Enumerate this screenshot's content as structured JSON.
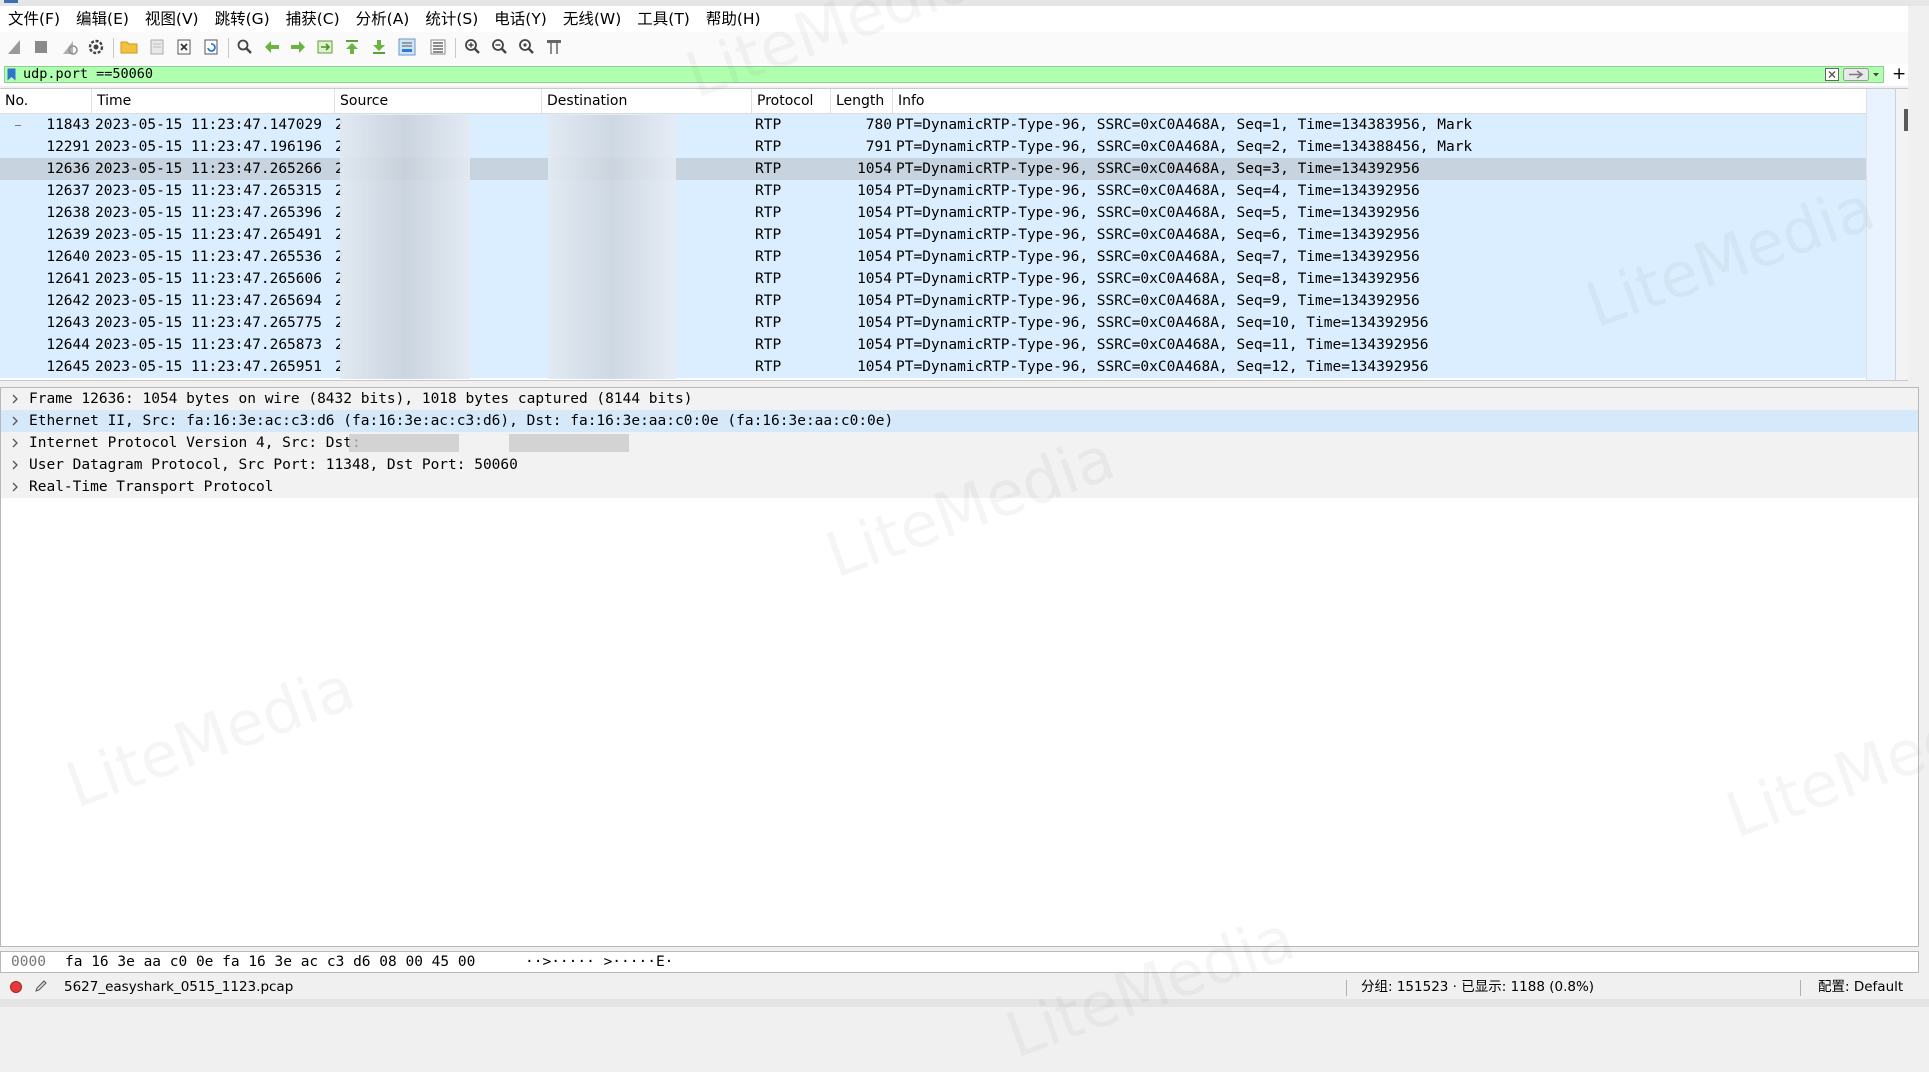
{
  "menu": [
    "文件(F)",
    "编辑(E)",
    "视图(V)",
    "跳转(G)",
    "捕获(C)",
    "分析(A)",
    "统计(S)",
    "电话(Y)",
    "无线(W)",
    "工具(T)",
    "帮助(H)"
  ],
  "toolbar_icons": [
    "shark-fin-start-icon",
    "stop-square-icon",
    "restart-fin-icon",
    "capture-options-gear-icon",
    "open-folder-icon",
    "save-file-icon",
    "close-file-icon",
    "reload-file-icon",
    "find-packet-icon",
    "go-back-icon",
    "go-forward-icon",
    "go-to-packet-icon",
    "first-packet-icon",
    "last-packet-icon",
    "auto-scroll-icon",
    "colorize-icon",
    "zoom-in-icon",
    "zoom-out-icon",
    "zoom-normal-icon",
    "resize-columns-icon"
  ],
  "filter": {
    "value": "udp.port ==50060"
  },
  "columns": [
    "No.",
    "Time",
    "Source",
    "Destination",
    "Protocol",
    "Length",
    "Info"
  ],
  "packets": [
    {
      "no": "11843",
      "time": "2023-05-15 11:23:47.147029",
      "source": "2",
      "dest": "",
      "proto": "RTP",
      "len": "780",
      "info": "PT=DynamicRTP-Type-96, SSRC=0xC0A468A, Seq=1, Time=134383956, Mark"
    },
    {
      "no": "12291",
      "time": "2023-05-15 11:23:47.196196",
      "source": "2",
      "dest": "",
      "proto": "RTP",
      "len": "791",
      "info": "PT=DynamicRTP-Type-96, SSRC=0xC0A468A, Seq=2, Time=134388456, Mark"
    },
    {
      "no": "12636",
      "time": "2023-05-15 11:23:47.265266",
      "source": "2",
      "dest": "",
      "proto": "RTP",
      "len": "1054",
      "info": "PT=DynamicRTP-Type-96, SSRC=0xC0A468A, Seq=3, Time=134392956"
    },
    {
      "no": "12637",
      "time": "2023-05-15 11:23:47.265315",
      "source": "2",
      "dest": "",
      "proto": "RTP",
      "len": "1054",
      "info": "PT=DynamicRTP-Type-96, SSRC=0xC0A468A, Seq=4, Time=134392956"
    },
    {
      "no": "12638",
      "time": "2023-05-15 11:23:47.265396",
      "source": "2",
      "dest": "",
      "proto": "RTP",
      "len": "1054",
      "info": "PT=DynamicRTP-Type-96, SSRC=0xC0A468A, Seq=5, Time=134392956"
    },
    {
      "no": "12639",
      "time": "2023-05-15 11:23:47.265491",
      "source": "2",
      "dest": "",
      "proto": "RTP",
      "len": "1054",
      "info": "PT=DynamicRTP-Type-96, SSRC=0xC0A468A, Seq=6, Time=134392956"
    },
    {
      "no": "12640",
      "time": "2023-05-15 11:23:47.265536",
      "source": "2",
      "dest": "",
      "proto": "RTP",
      "len": "1054",
      "info": "PT=DynamicRTP-Type-96, SSRC=0xC0A468A, Seq=7, Time=134392956"
    },
    {
      "no": "12641",
      "time": "2023-05-15 11:23:47.265606",
      "source": "2",
      "dest": "",
      "proto": "RTP",
      "len": "1054",
      "info": "PT=DynamicRTP-Type-96, SSRC=0xC0A468A, Seq=8, Time=134392956"
    },
    {
      "no": "12642",
      "time": "2023-05-15 11:23:47.265694",
      "source": "2",
      "dest": "",
      "proto": "RTP",
      "len": "1054",
      "info": "PT=DynamicRTP-Type-96, SSRC=0xC0A468A, Seq=9, Time=134392956"
    },
    {
      "no": "12643",
      "time": "2023-05-15 11:23:47.265775",
      "source": "2",
      "dest": "",
      "proto": "RTP",
      "len": "1054",
      "info": "PT=DynamicRTP-Type-96, SSRC=0xC0A468A, Seq=10, Time=134392956"
    },
    {
      "no": "12644",
      "time": "2023-05-15 11:23:47.265873",
      "source": "2",
      "dest": "",
      "proto": "RTP",
      "len": "1054",
      "info": "PT=DynamicRTP-Type-96, SSRC=0xC0A468A, Seq=11, Time=134392956"
    },
    {
      "no": "12645",
      "time": "2023-05-15 11:23:47.265951",
      "source": "2",
      "dest": "",
      "proto": "RTP",
      "len": "1054",
      "info": "PT=DynamicRTP-Type-96, SSRC=0xC0A468A, Seq=12, Time=134392956"
    }
  ],
  "details": [
    "Frame 12636: 1054 bytes on wire (8432 bits), 1018 bytes captured (8144 bits)",
    "Ethernet II, Src: fa:16:3e:ac:c3:d6 (fa:16:3e:ac:c3:d6), Dst: fa:16:3e:aa:c0:0e (fa:16:3e:aa:c0:0e)",
    "Internet Protocol Version 4, Src:                Dst:",
    "User Datagram Protocol, Src Port: 11348, Dst Port: 50060",
    "Real-Time Transport Protocol"
  ],
  "bytes": {
    "offset": "0000",
    "hex": "fa 16 3e aa c0 0e fa 16  3e ac c3 d6 08 00 45 00",
    "ascii": "··>····· >·····E·"
  },
  "status": {
    "file": "5627_easyshark_0515_1123.pcap",
    "packets": "分组: 151523 · 已显示: 1188 (0.8%)",
    "profile": "配置: Default"
  },
  "watermark": "LiteMedia",
  "colors": {
    "row_bg": "#daeeff",
    "row_selected": "#c7d3df",
    "filter_valid": "#afffaf",
    "detail_highlight": "#d6e9fb",
    "status_dot": "#e23b3b"
  }
}
